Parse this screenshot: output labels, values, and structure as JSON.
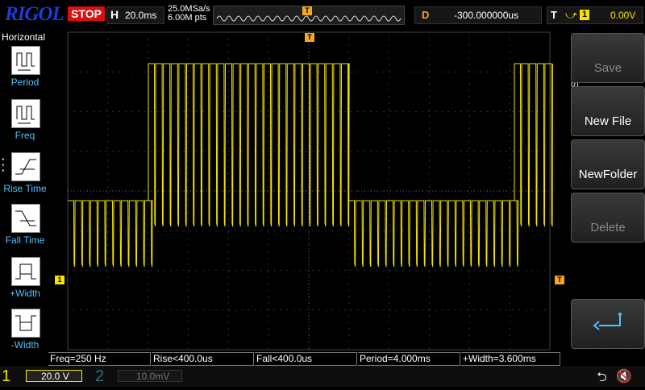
{
  "top": {
    "logo": "RIGOL",
    "run_status": "STOP",
    "timebase_letter": "H",
    "timebase": "20.0ms",
    "sample_rate": "25.0MSa/s",
    "memory_depth": "6.00M pts",
    "trigger_marker": "T",
    "delay_letter": "D",
    "delay": "-300.000000us",
    "trigger_letter": "T",
    "trigger_edge": "rising-edge-icon",
    "trigger_source": "1",
    "trigger_level": "0.00V"
  },
  "left_menu": {
    "title": "Horizontal",
    "items": [
      {
        "label": "Period",
        "icon": "period-icon"
      },
      {
        "label": "Freq",
        "icon": "frequency-icon"
      },
      {
        "label": "Rise Time",
        "icon": "rise-time-icon"
      },
      {
        "label": "Fall Time",
        "icon": "fall-time-icon"
      },
      {
        "label": "+Width",
        "icon": "positive-width-icon"
      },
      {
        "label": "-Width",
        "icon": "negative-width-icon"
      }
    ]
  },
  "right_menu": {
    "title": "Save",
    "buttons": [
      {
        "label": "Save",
        "enabled": false
      },
      {
        "label": "New File",
        "enabled": true
      },
      {
        "label": "NewFolder",
        "enabled": true
      },
      {
        "label": "Delete",
        "enabled": false
      }
    ],
    "back_icon": "return-arrow-icon"
  },
  "markers": {
    "ch1_ground": "1",
    "trigger_level_marker": "T",
    "trigger_position": "T"
  },
  "measurements": [
    "Freq=250 Hz",
    "Rise<400.0us",
    "Fall<400.0us",
    "Period=4.000ms",
    "+Width=3.600ms"
  ],
  "bottom": {
    "ch1_number": "1",
    "ch1_scale": "20.0 V",
    "ch2_number": "2",
    "ch2_scale": "10.0mV",
    "usb_icon": "usb-icon",
    "mute_icon": "speaker-muted-icon"
  },
  "colors": {
    "trace": "#f5e300",
    "accent_orange": "#f5a623",
    "label_blue": "#4fc3ff",
    "stop_red": "#d81010",
    "logo_blue": "#1a3cd8"
  }
}
